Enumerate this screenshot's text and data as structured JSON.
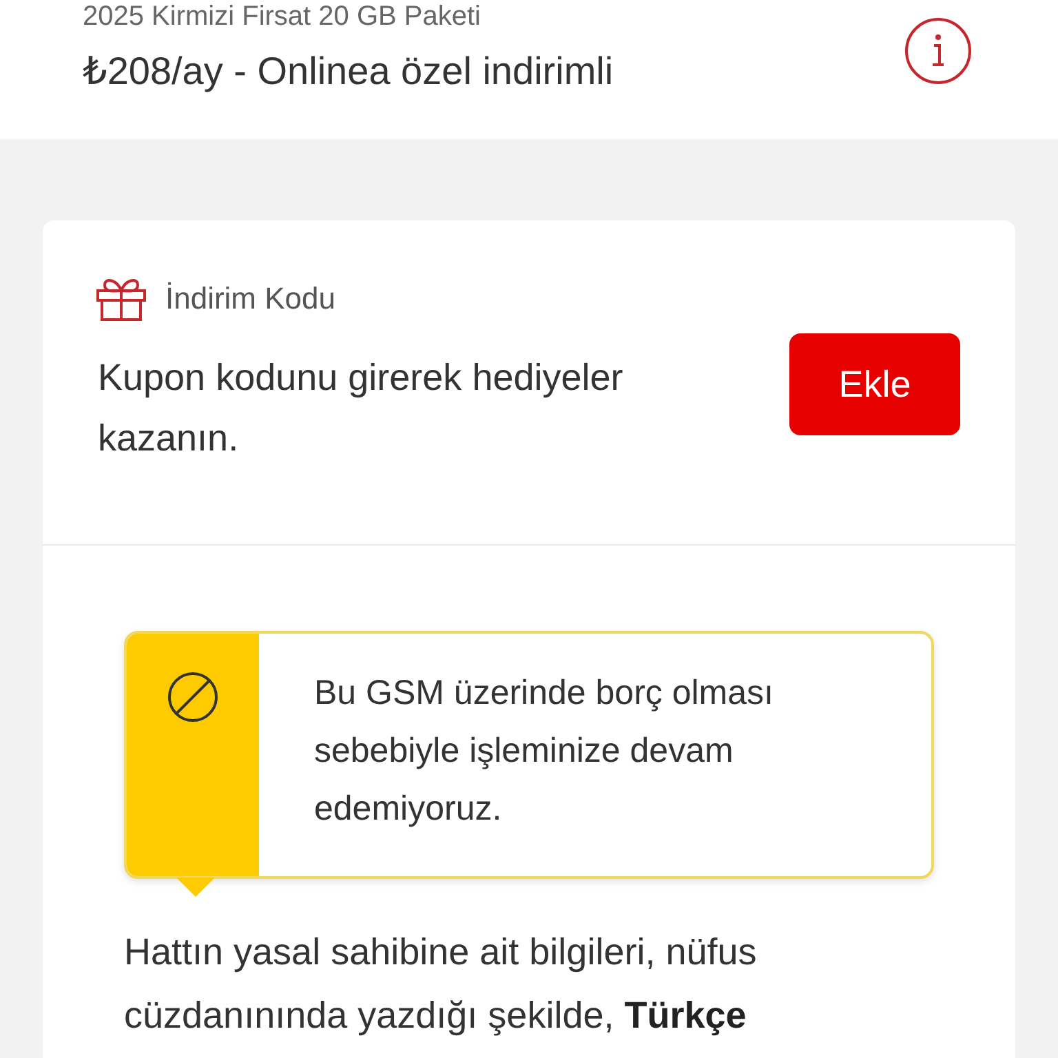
{
  "header": {
    "package_name": "2025 Kirmizi Firsat 20 GB Paketi",
    "price": "₺208/ay - Onlinea özel indirimli"
  },
  "discount_card": {
    "title": "İndirim Kodu",
    "description": "Kupon kodunu girerek hediyeler kazanın.",
    "button": "Ekle"
  },
  "warning": {
    "message": "Bu GSM üzerinde borç olması sebebiyle işleminize devam edemiyoruz."
  },
  "instruction": "Hattın yasal sahibine ait bilgileri, nüfus cüzdanınında yazdığı şekilde, **Türkçe**"
}
